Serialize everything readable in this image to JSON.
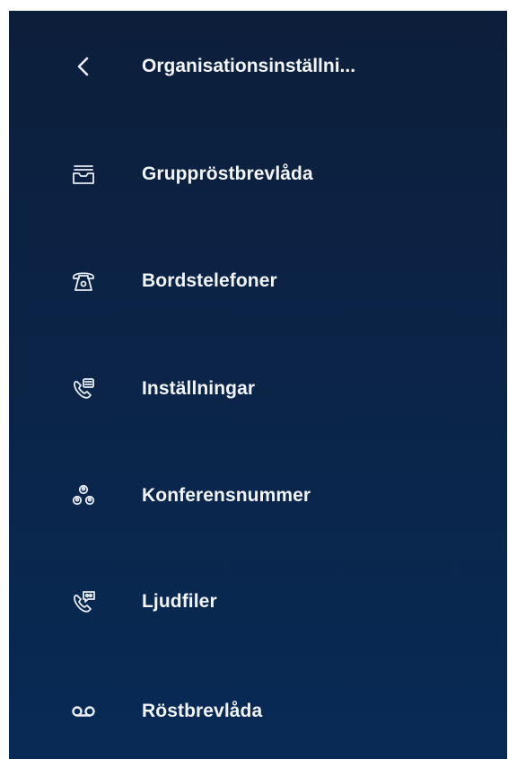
{
  "header": {
    "back_icon": "chevron-left-icon",
    "title": "Organisationsinställni..."
  },
  "menu": {
    "items": [
      {
        "label": "Gruppröstbrevlåda",
        "icon": "inbox-tray-icon"
      },
      {
        "label": "Bordstelefoner",
        "icon": "desk-phone-icon"
      },
      {
        "label": "Inställningar",
        "icon": "phone-settings-icon"
      },
      {
        "label": "Konferensnummer",
        "icon": "conference-people-icon"
      },
      {
        "label": "Ljudfiler",
        "icon": "phone-audio-icon"
      },
      {
        "label": "Röstbrevlåda",
        "icon": "voicemail-icon"
      }
    ]
  },
  "colors": {
    "background_top": "#0c1e3a",
    "background_bottom": "#082a55",
    "text": "#f2f5fa"
  }
}
